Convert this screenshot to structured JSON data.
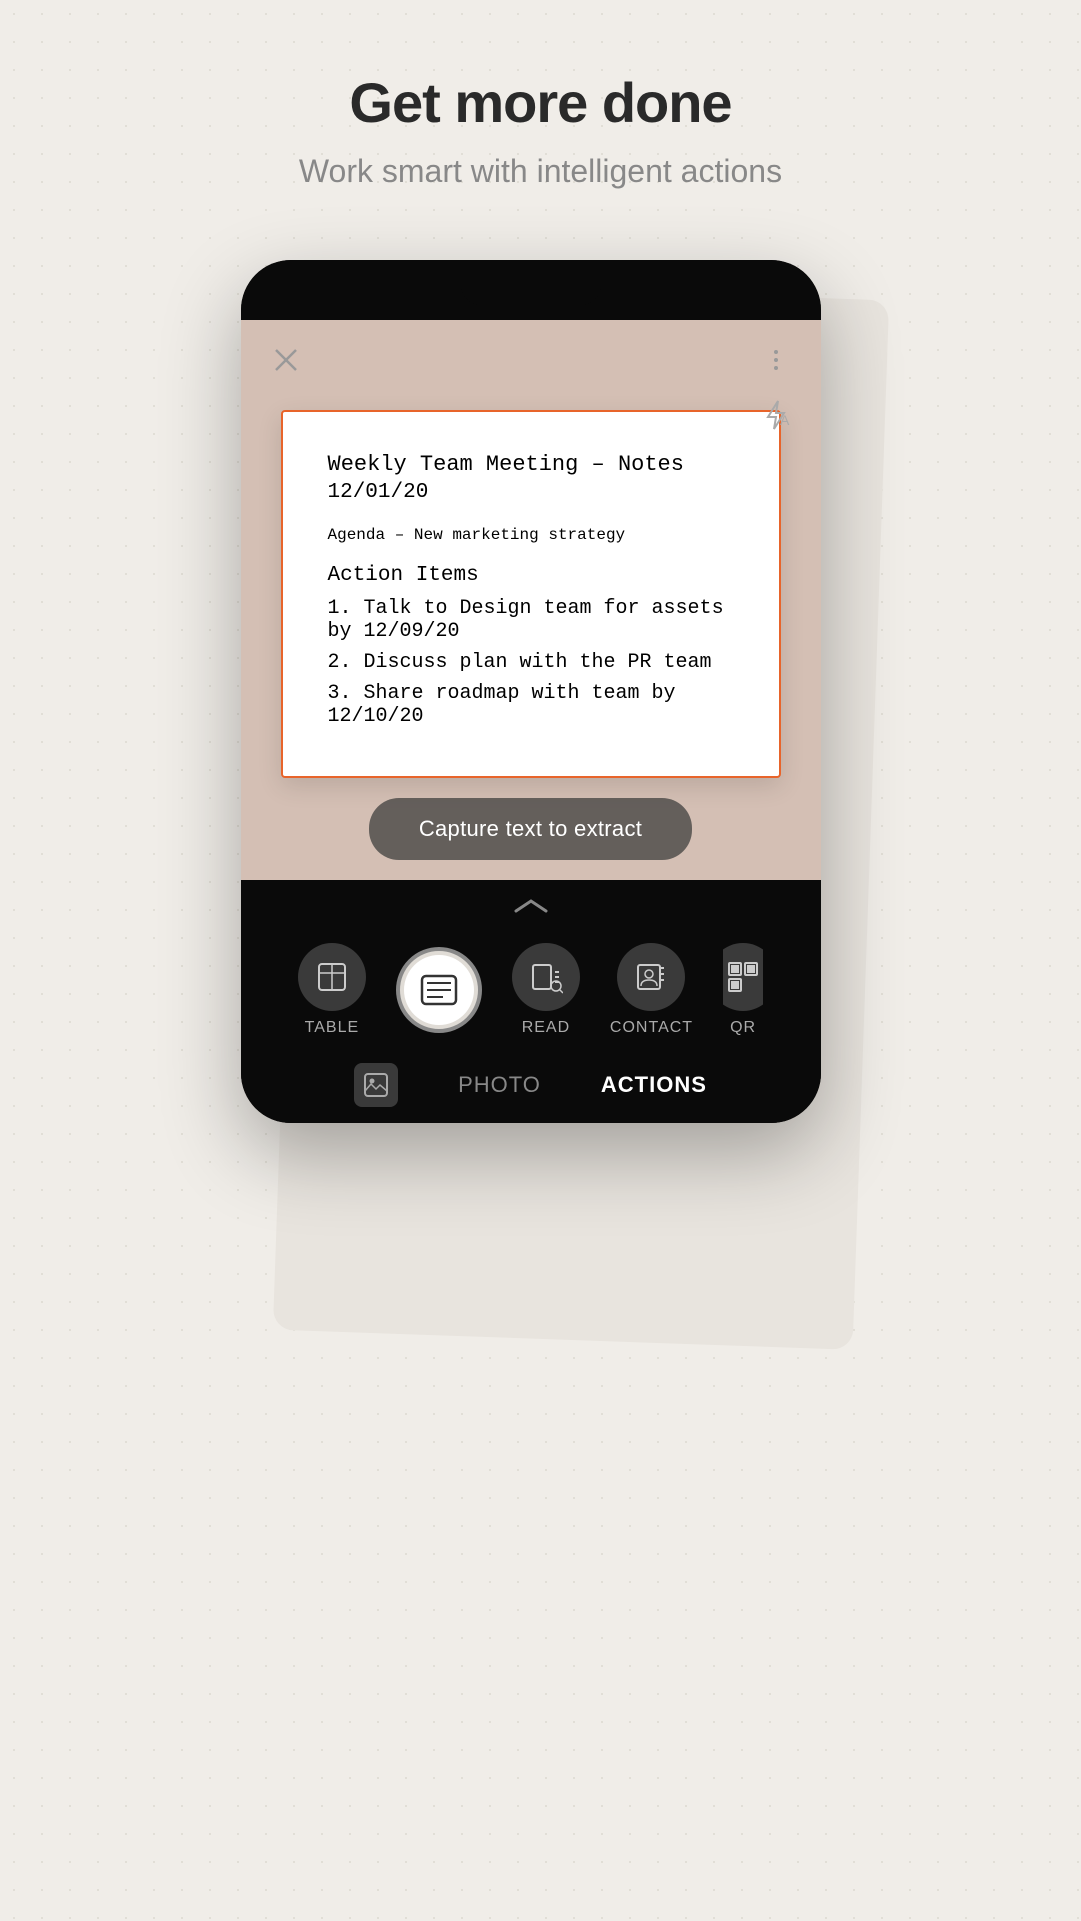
{
  "header": {
    "title": "Get more done",
    "subtitle": "Work smart with intelligent actions"
  },
  "phone": {
    "close_btn": "✕",
    "document": {
      "title": "Weekly Team Meeting – Notes",
      "date": "12/01/20",
      "agenda": "Agenda – New marketing strategy",
      "section_title": "Action Items",
      "items": [
        "1. Talk to Design team for assets by 12/09/20",
        "2. Discuss plan with the PR team",
        "3. Share roadmap with team by 12/10/20"
      ]
    },
    "capture_button": "Capture text to extract",
    "bottom_tabs": {
      "table_label": "TABLE",
      "read_label": "READ",
      "contact_label": "CONTACT",
      "qr_label": "QR"
    },
    "nav": {
      "photo_label": "PHOTO",
      "actions_label": "ACTIONS"
    }
  }
}
